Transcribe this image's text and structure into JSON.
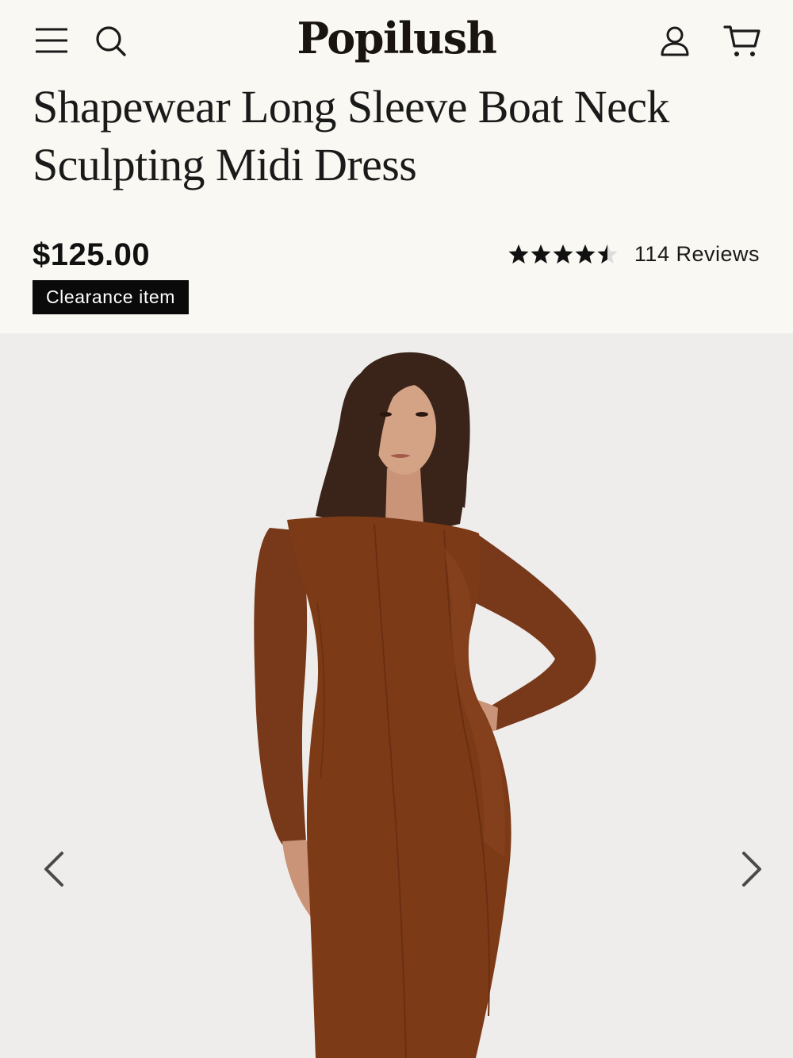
{
  "header": {
    "logo": "Popilush",
    "icons": [
      "menu-icon",
      "search-icon",
      "account-icon",
      "cart-icon"
    ]
  },
  "product": {
    "title": "Shapewear Long Sleeve Boat Neck Sculpting Midi Dress",
    "price": "$125.00",
    "badge": "Clearance item",
    "rating": 4.5,
    "rating_max": 5,
    "reviews_label": "114 Reviews"
  },
  "gallery": {
    "icons": [
      "chevron-left-icon",
      "chevron-right-icon"
    ]
  },
  "colors": {
    "background": "#f9f8f2",
    "gallery_background": "#efedeb",
    "dress": "#7d3a17",
    "badge_background": "#0a0a0a",
    "text": "#111111"
  }
}
